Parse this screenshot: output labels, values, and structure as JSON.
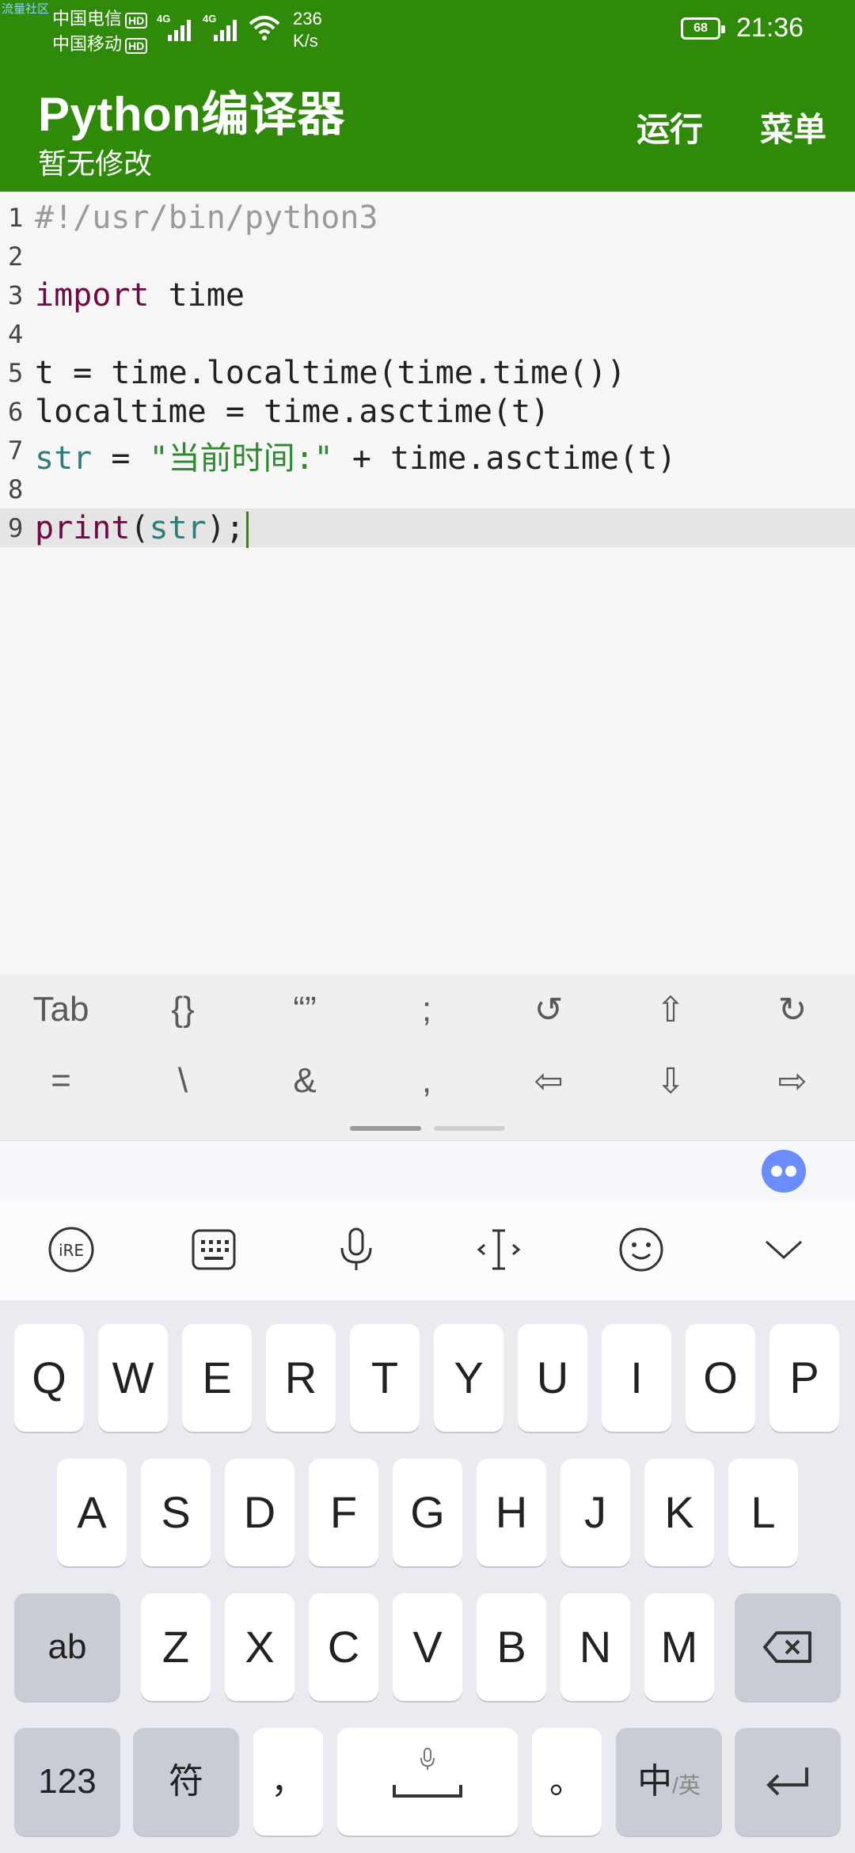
{
  "status": {
    "watermark": "流量社区",
    "carrier1": "中国电信",
    "carrier2": "中国移动",
    "hd": "HD",
    "net_gen": "4G",
    "speed_value": "236",
    "speed_unit": "K/s",
    "battery": "68",
    "time": "21:36"
  },
  "appbar": {
    "title": "Python编译器",
    "subtitle": "暂无修改",
    "run_label": "运行",
    "menu_label": "菜单",
    "color": "#2f8a0a"
  },
  "editor": {
    "lines": [
      {
        "num": "1",
        "text": "#!/usr/bin/python3"
      },
      {
        "num": "2",
        "text": ""
      },
      {
        "num": "3",
        "kw": "import",
        "rest": " time"
      },
      {
        "num": "4",
        "text": ""
      },
      {
        "num": "5",
        "text": "t = time.localtime(time.time())"
      },
      {
        "num": "6",
        "text": "localtime = time.asctime(t)"
      },
      {
        "num": "7",
        "bi": "str",
        "op": " = ",
        "str": "\"当前时间:\"",
        "rest": " + time.asctime(t)"
      },
      {
        "num": "8",
        "text": ""
      },
      {
        "num": "9",
        "kw": "print",
        "p1": "(",
        "bi": "str",
        "p2": ");"
      }
    ],
    "active_line": "9"
  },
  "symbols": {
    "row1": [
      "Tab",
      "{}",
      "“”",
      ";",
      "↺",
      "⇧",
      "↻"
    ],
    "row2": [
      "=",
      "\\",
      "&",
      ",",
      "⇦",
      "⇩",
      "⇨"
    ]
  },
  "keyboard": {
    "row1": [
      "Q",
      "W",
      "E",
      "R",
      "T",
      "Y",
      "U",
      "I",
      "O",
      "P"
    ],
    "row2": [
      "A",
      "S",
      "D",
      "F",
      "G",
      "H",
      "J",
      "K",
      "L"
    ],
    "row3": [
      "Z",
      "X",
      "C",
      "V",
      "B",
      "N",
      "M"
    ],
    "shift_label": "ab",
    "num_label": "123",
    "sym_label": "符",
    "comma_label": "，",
    "period_label": "。",
    "lang_label": "中",
    "lang_sub": "/英"
  },
  "icons": [
    "handwriting-icon",
    "keyboard-icon",
    "microphone-icon",
    "cursor-icon",
    "emoji-icon",
    "collapse-icon",
    "backspace-icon",
    "enter-icon"
  ]
}
